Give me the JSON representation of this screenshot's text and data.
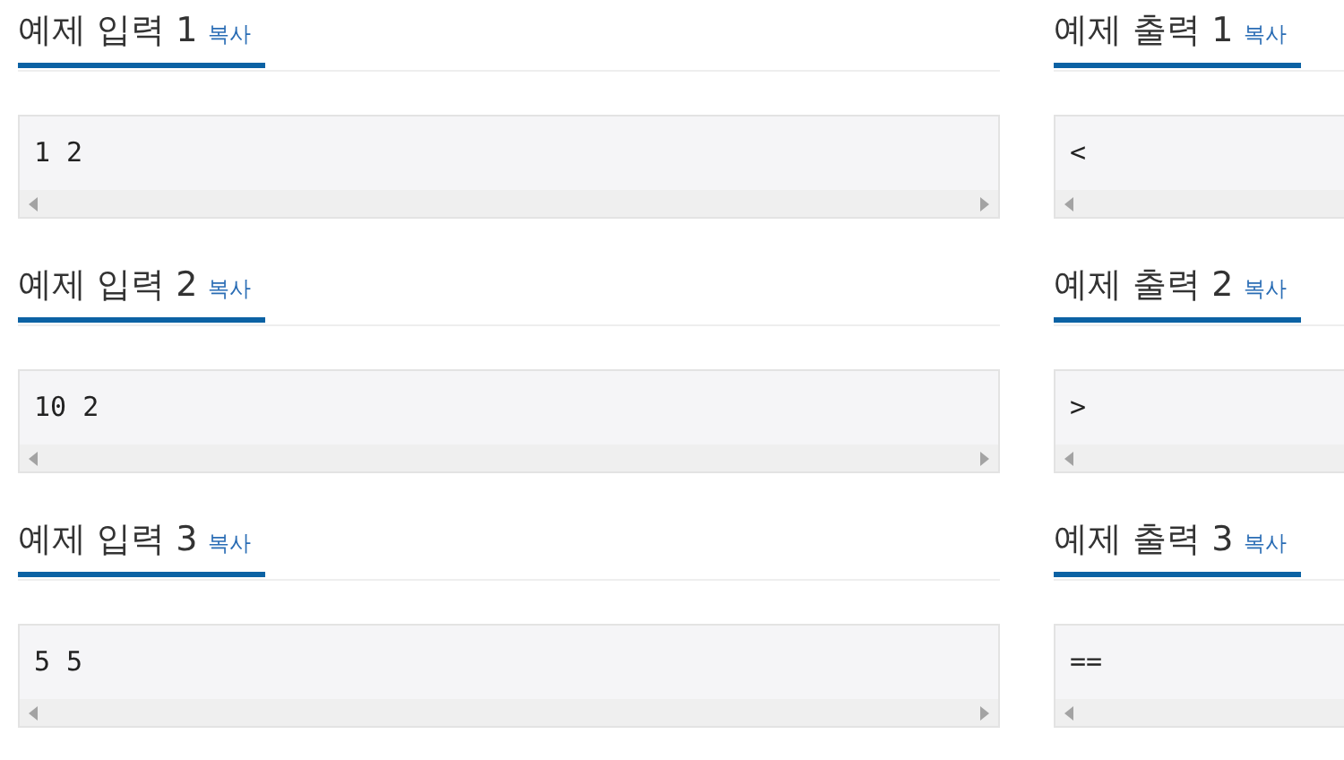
{
  "examples": [
    {
      "input": {
        "title": "예제 입력 1",
        "copy": "복사",
        "value": "1 2"
      },
      "output": {
        "title": "예제 출력 1",
        "copy": "복사",
        "value": "<"
      }
    },
    {
      "input": {
        "title": "예제 입력 2",
        "copy": "복사",
        "value": "10 2"
      },
      "output": {
        "title": "예제 출력 2",
        "copy": "복사",
        "value": ">"
      }
    },
    {
      "input": {
        "title": "예제 입력 3",
        "copy": "복사",
        "value": "5 5"
      },
      "output": {
        "title": "예제 출력 3",
        "copy": "복사",
        "value": "=="
      }
    }
  ]
}
